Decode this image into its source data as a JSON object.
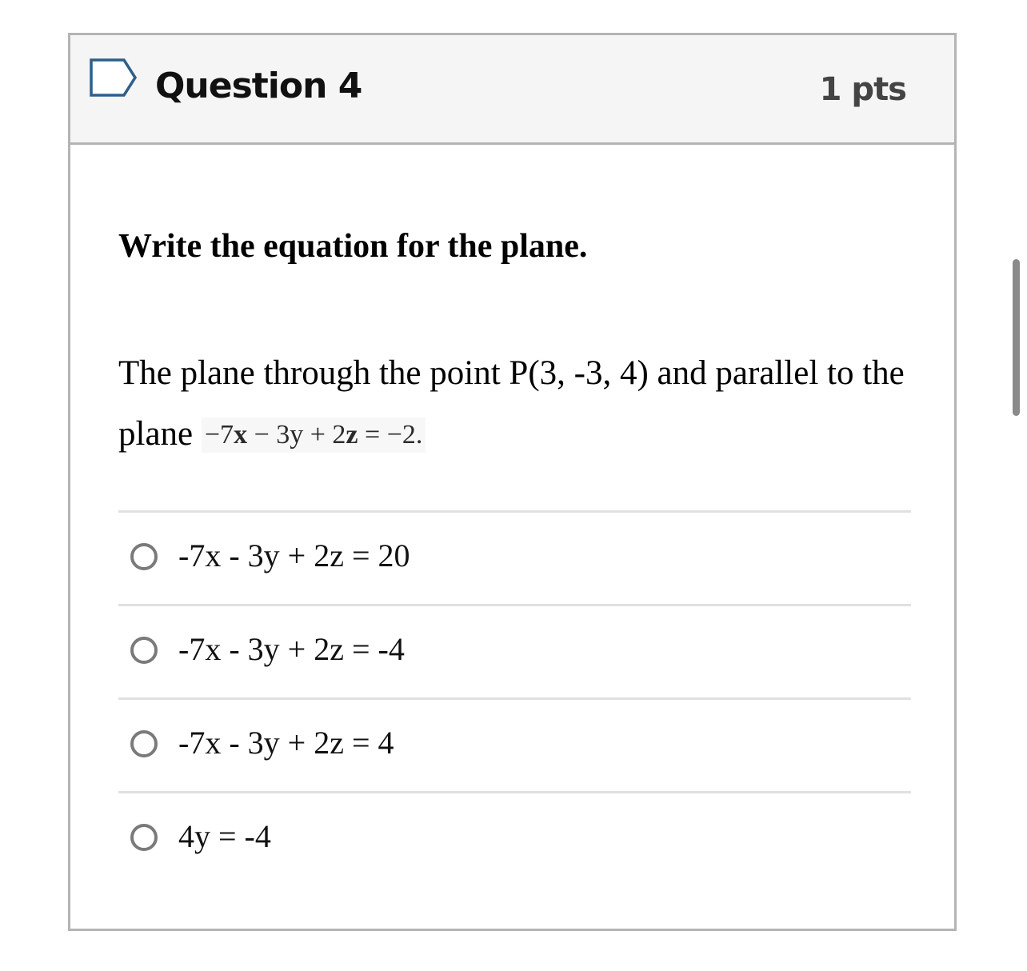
{
  "question": {
    "title": "Question 4",
    "points": "1 pts",
    "prompt_heading": "Write the equation for the plane.",
    "prompt_body": "The plane through the point P(3, -3, 4) and parallel to the plane",
    "reference_equation": {
      "part1": "−7",
      "var_x": "x",
      "part2": " − 3y + 2",
      "var_z": "z",
      "part3": " = −2."
    }
  },
  "answers": [
    {
      "label": "-7x - 3y + 2z = 20"
    },
    {
      "label": "-7x - 3y + 2z = -4"
    },
    {
      "label": "-7x - 3y + 2z = 4"
    },
    {
      "label": "4y = -4"
    }
  ],
  "colors": {
    "header_bg": "#f5f5f5",
    "border": "#b4b4b4",
    "flag_stroke": "#2d5f8a",
    "radio_stroke": "#7a7a7a"
  },
  "icons": {
    "flag": "flag-outline-icon",
    "radio": "radio-unchecked-icon"
  }
}
